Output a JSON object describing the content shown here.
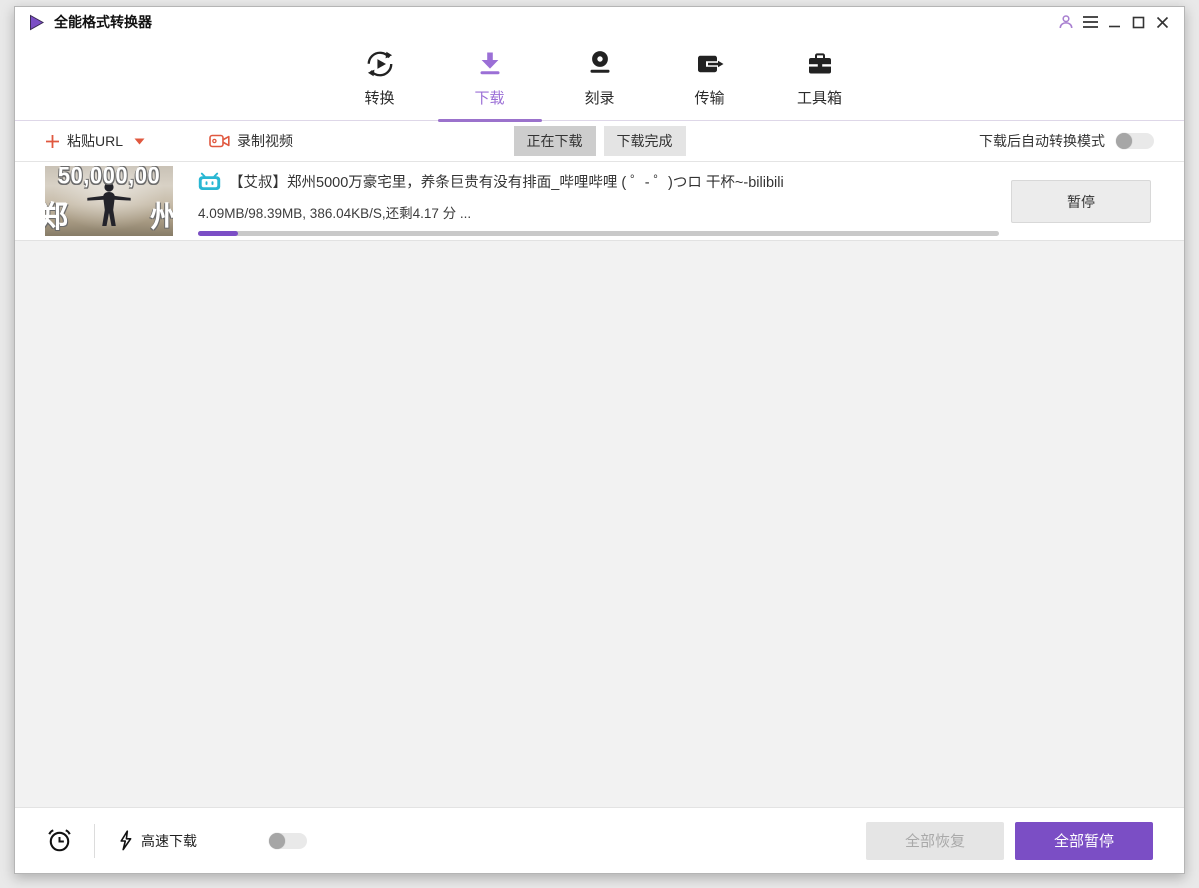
{
  "app": {
    "title": "全能格式转换器",
    "colors": {
      "accent_purple": "#7b4ec5",
      "nav_active_purple": "#9b6fd6",
      "action_red": "#e0583f",
      "bilibili_blue": "#29b7d3",
      "progress_track": "#c9c9c9"
    }
  },
  "nav": {
    "tabs": [
      {
        "label": "转换",
        "active": false
      },
      {
        "label": "下载",
        "active": true
      },
      {
        "label": "刻录",
        "active": false
      },
      {
        "label": "传输",
        "active": false
      },
      {
        "label": "工具箱",
        "active": false
      }
    ]
  },
  "toolbar": {
    "paste_url_label": "粘贴URL",
    "record_video_label": "录制视频",
    "subtabs": [
      {
        "label": "正在下载",
        "active": true
      },
      {
        "label": "下载完成",
        "active": false
      }
    ],
    "auto_convert_label": "下载后自动转换模式",
    "auto_convert_enabled": false
  },
  "downloads": {
    "items": [
      {
        "title": "【艾叔】郑州5000万豪宅里，养条巨贵有没有排面_哔哩哔哩 ( ゜- ゜)つロ 干杯~-bilibili",
        "progress_text": "4.09MB/98.39MB, 386.04KB/S,还剩4.17 分 ...",
        "progress_percent": 5,
        "pause_label": "暂停",
        "thumbnail": {
          "top_text": "50,000,00",
          "left_char": "郑",
          "right_char": "州"
        }
      }
    ]
  },
  "footer": {
    "speed_download_label": "高速下载",
    "speed_download_enabled": false,
    "resume_all_label": "全部恢复",
    "pause_all_label": "全部暂停"
  }
}
